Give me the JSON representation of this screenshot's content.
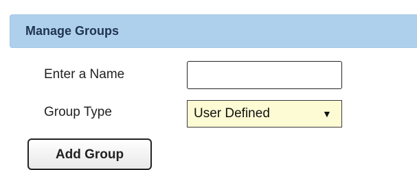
{
  "panel": {
    "title": "Manage Groups"
  },
  "form": {
    "name_label": "Enter a Name",
    "name_value": "",
    "name_placeholder": "",
    "type_label": "Group Type",
    "type_selected": "User Defined",
    "type_arrow_icon": "triangle-down-icon"
  },
  "actions": {
    "add_group_label": "Add Group"
  },
  "colors": {
    "header_background": "#aed0ec",
    "header_text": "#203550",
    "select_background": "#fdfbd3"
  }
}
